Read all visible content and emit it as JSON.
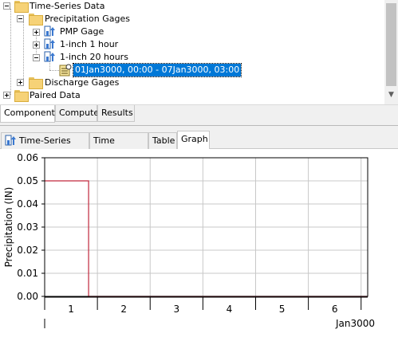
{
  "tree": {
    "items": [
      {
        "label": "Time-Series Data"
      },
      {
        "label": "Precipitation Gages"
      },
      {
        "label": "PMP Gage"
      },
      {
        "label": "1-inch 1 hour"
      },
      {
        "label": "1-inch 20 hours"
      },
      {
        "label": "01Jan3000, 00:00 - 07Jan3000, 03:00"
      },
      {
        "label": "Discharge Gages"
      },
      {
        "label": "Paired Data"
      }
    ]
  },
  "component_tabs": [
    "Components",
    "Compute",
    "Results"
  ],
  "editor_tabs": [
    "Time-Series Gage",
    "Time Window",
    "Table",
    "Graph"
  ],
  "colors": {
    "series": "#c0283c",
    "selection": "#0078d7"
  },
  "chart_data": {
    "type": "line",
    "ylabel": "Precipitation (IN)",
    "xlabel": "Jan3000",
    "ylim": [
      0,
      0.06
    ],
    "yticks": [
      "0.06",
      "0.05",
      "0.04",
      "0.03",
      "0.02",
      "0.01",
      "0.00"
    ],
    "categories": [
      "1",
      "2",
      "3",
      "4",
      "5",
      "6"
    ],
    "x_day_range": [
      1,
      7.125
    ],
    "series": [
      {
        "name": "",
        "style": "step",
        "points": [
          [
            1,
            0.05
          ],
          [
            1.833,
            0.05
          ],
          [
            1.833,
            0.0
          ],
          [
            7.125,
            0.0
          ]
        ]
      }
    ],
    "grid": true
  }
}
